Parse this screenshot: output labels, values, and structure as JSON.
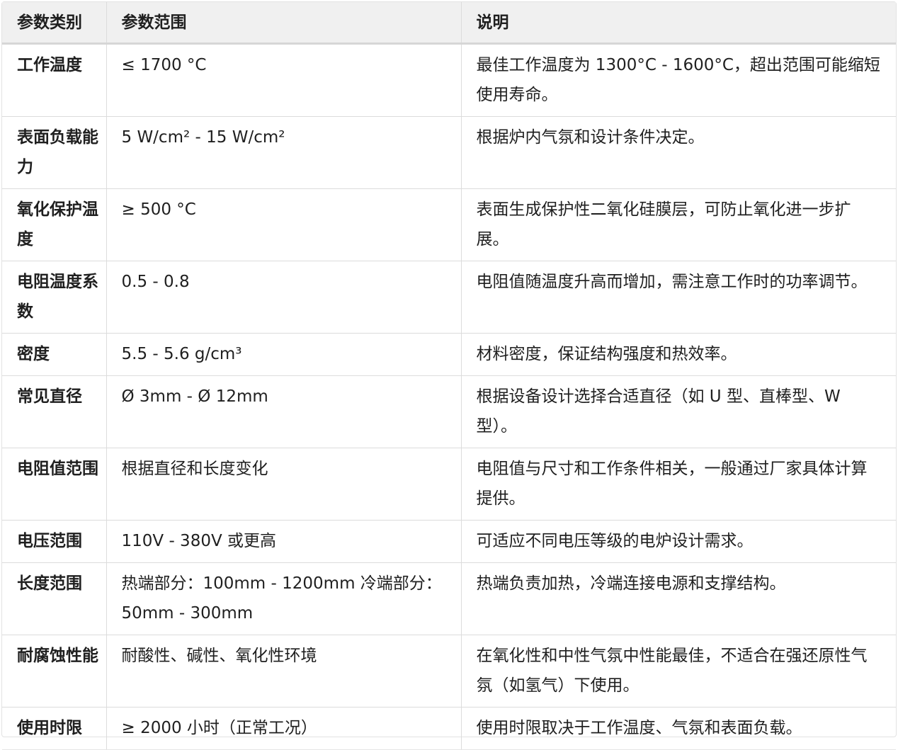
{
  "headers": [
    "参数类别",
    "参数范围",
    "说明"
  ],
  "rows": [
    [
      "工作温度",
      "≤ 1700 °C",
      "最佳工作温度为 1300°C - 1600°C，超出范围可能缩短使用寿命。"
    ],
    [
      "表面负载能力",
      "5 W/cm² - 15 W/cm²",
      "根据炉内气氛和设计条件决定。"
    ],
    [
      "氧化保护温度",
      "≥ 500 °C",
      "表面生成保护性二氧化硅膜层，可防止氧化进一步扩展。"
    ],
    [
      "电阻温度系数",
      "0.5 - 0.8",
      "电阻值随温度升高而增加，需注意工作时的功率调节。"
    ],
    [
      "密度",
      "5.5 - 5.6 g/cm³",
      "材料密度，保证结构强度和热效率。"
    ],
    [
      "常见直径",
      "Ø 3mm - Ø 12mm",
      "根据设备设计选择合适直径（如 U 型、直棒型、W 型）。"
    ],
    [
      "电阻值范围",
      "根据直径和长度变化",
      "电阻值与尺寸和工作条件相关，一般通过厂家具体计算提供。"
    ],
    [
      "电压范围",
      "110V - 380V 或更高",
      "可适应不同电压等级的电炉设计需求。"
    ],
    [
      "长度范围",
      "热端部分：100mm - 1200mm 冷端部分：50mm - 300mm",
      "热端负责加热，冷端连接电源和支撑结构。"
    ],
    [
      "耐腐蚀性能",
      "耐酸性、碱性、氧化性环境",
      "在氧化性和中性气氛中性能最佳，不适合在强还原性气氛（如氢气）下使用。"
    ],
    [
      "使用时限",
      "≥ 2000 小时（正常工况）",
      "使用时限取决于工作温度、气氛和表面负载。"
    ]
  ]
}
